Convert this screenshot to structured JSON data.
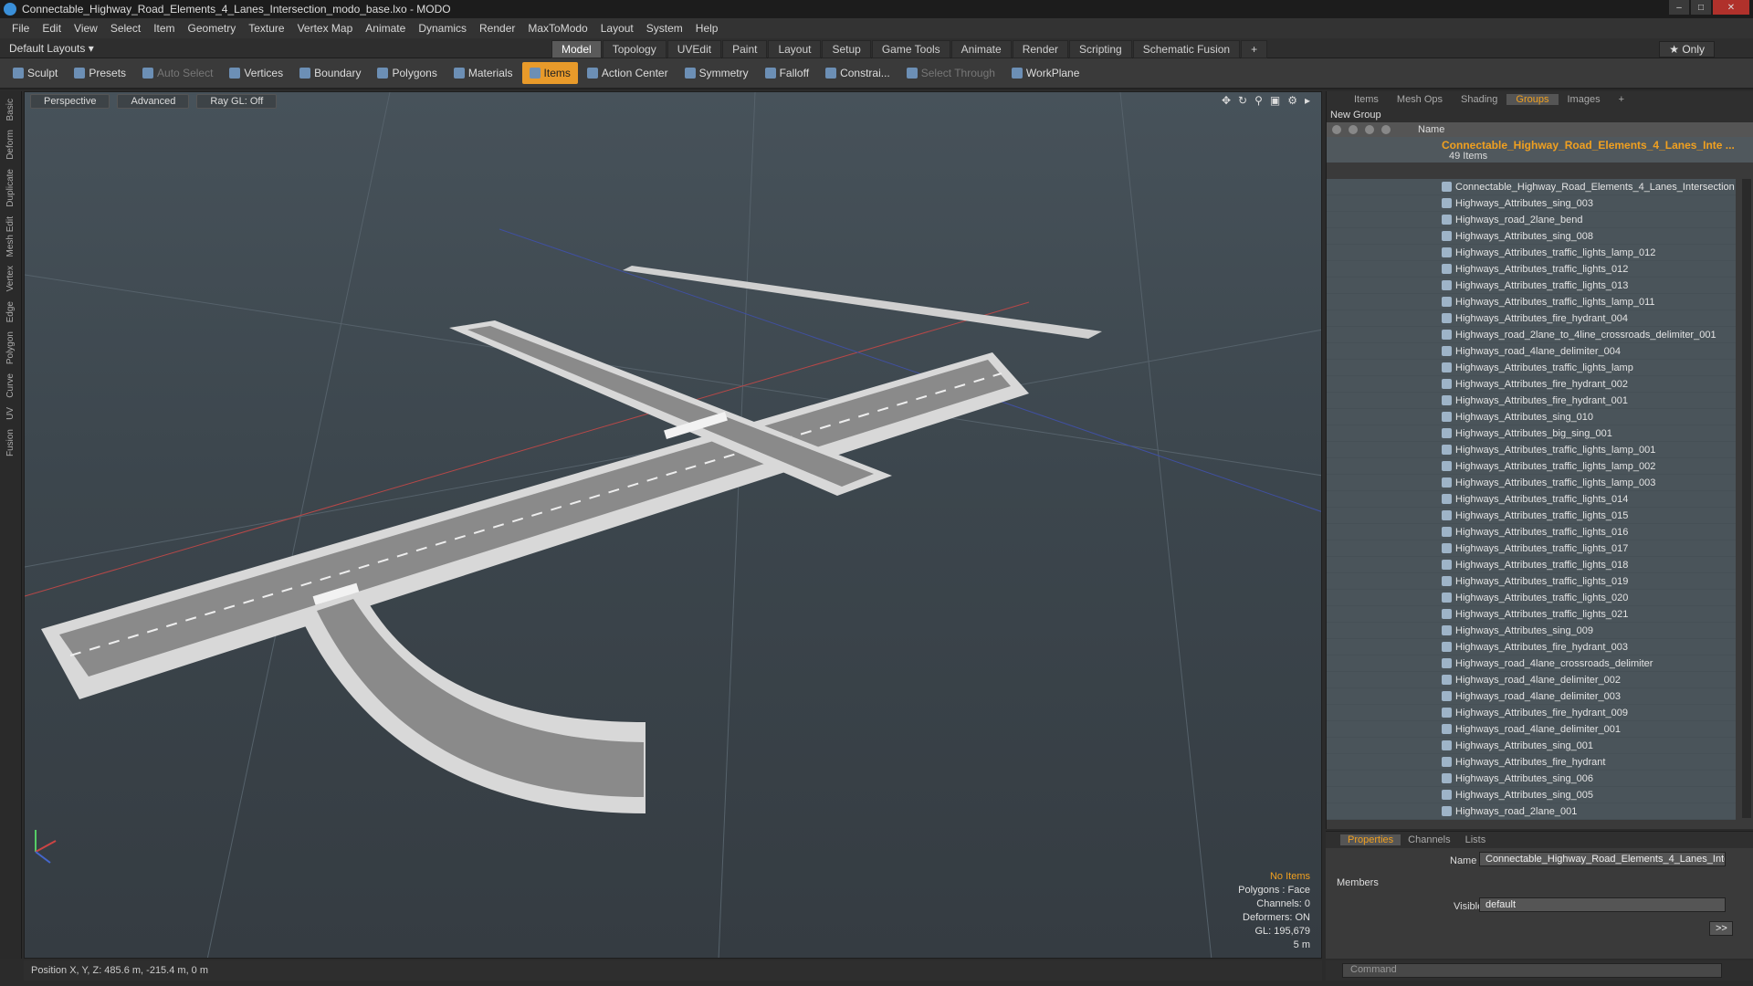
{
  "window": {
    "title": "Connectable_Highway_Road_Elements_4_Lanes_Intersection_modo_base.lxo - MODO"
  },
  "menu": [
    "File",
    "Edit",
    "View",
    "Select",
    "Item",
    "Geometry",
    "Texture",
    "Vertex Map",
    "Animate",
    "Dynamics",
    "Render",
    "MaxToModo",
    "Layout",
    "System",
    "Help"
  ],
  "layout": {
    "default_layouts": "Default Layouts",
    "tabs": [
      "Model",
      "Topology",
      "UVEdit",
      "Paint",
      "Layout",
      "Setup",
      "Game Tools",
      "Animate",
      "Render",
      "Scripting",
      "Schematic Fusion"
    ],
    "active_tab": "Model",
    "only": "Only"
  },
  "toolbar": {
    "sculpt": "Sculpt",
    "presets": "Presets",
    "auto_select": "Auto Select",
    "vertices": "Vertices",
    "boundary": "Boundary",
    "polygons": "Polygons",
    "materials": "Materials",
    "items": "Items",
    "action_center": "Action Center",
    "symmetry": "Symmetry",
    "falloff": "Falloff",
    "constraints": "Constrai...",
    "select_through": "Select Through",
    "workplane": "WorkPlane"
  },
  "left_strip": [
    "Basic",
    "Deform",
    "Duplicate",
    "Mesh Edit",
    "Vertex",
    "Edge",
    "Polygon",
    "Curve",
    "UV",
    "Fusion"
  ],
  "viewport": {
    "perspective": "Perspective",
    "advanced": "Advanced",
    "raygl": "Ray GL: Off",
    "stats": {
      "no_items": "No Items",
      "polygons": "Polygons : Face",
      "channels": "Channels: 0",
      "deformers": "Deformers: ON",
      "gl": "GL: 195,679",
      "scale": "5 m"
    }
  },
  "status": {
    "position": "Position X, Y, Z:   485.6 m, -215.4 m, 0 m"
  },
  "right_panel": {
    "tabs": [
      "Items",
      "Mesh Ops",
      "Shading",
      "Groups",
      "Images"
    ],
    "active_tab": "Groups",
    "new_group": "New Group",
    "name_header": "Name",
    "group_name": "Connectable_Highway_Road_Elements_4_Lanes_Inte ...",
    "group_count": "49 Items",
    "items": [
      "Connectable_Highway_Road_Elements_4_Lanes_Intersection",
      "Highways_Attributes_sing_003",
      "Highways_road_2lane_bend",
      "Highways_Attributes_sing_008",
      "Highways_Attributes_traffic_lights_lamp_012",
      "Highways_Attributes_traffic_lights_012",
      "Highways_Attributes_traffic_lights_013",
      "Highways_Attributes_traffic_lights_lamp_011",
      "Highways_Attributes_fire_hydrant_004",
      "Highways_road_2lane_to_4line_crossroads_delimiter_001",
      "Highways_road_4lane_delimiter_004",
      "Highways_Attributes_traffic_lights_lamp",
      "Highways_Attributes_fire_hydrant_002",
      "Highways_Attributes_fire_hydrant_001",
      "Highways_Attributes_sing_010",
      "Highways_Attributes_big_sing_001",
      "Highways_Attributes_traffic_lights_lamp_001",
      "Highways_Attributes_traffic_lights_lamp_002",
      "Highways_Attributes_traffic_lights_lamp_003",
      "Highways_Attributes_traffic_lights_014",
      "Highways_Attributes_traffic_lights_015",
      "Highways_Attributes_traffic_lights_016",
      "Highways_Attributes_traffic_lights_017",
      "Highways_Attributes_traffic_lights_018",
      "Highways_Attributes_traffic_lights_019",
      "Highways_Attributes_traffic_lights_020",
      "Highways_Attributes_traffic_lights_021",
      "Highways_Attributes_sing_009",
      "Highways_Attributes_fire_hydrant_003",
      "Highways_road_4lane_crossroads_delimiter",
      "Highways_road_4lane_delimiter_002",
      "Highways_road_4lane_delimiter_003",
      "Highways_Attributes_fire_hydrant_009",
      "Highways_road_4lane_delimiter_001",
      "Highways_Attributes_sing_001",
      "Highways_Attributes_fire_hydrant",
      "Highways_Attributes_sing_006",
      "Highways_Attributes_sing_005",
      "Highways_road_2lane_001"
    ]
  },
  "properties": {
    "tabs": [
      "Properties",
      "Channels",
      "Lists"
    ],
    "active_tab": "Properties",
    "name_label": "Name",
    "name_value": "Connectable_Highway_Road_Elements_4_Lanes_Inte",
    "members": "Members",
    "visible_label": "Visible",
    "visible_value": "default",
    "arrow_btn": ">>"
  },
  "command": {
    "placeholder": "Command"
  },
  "colors": {
    "accent": "#e89a2a",
    "group_name": "#f0a020"
  }
}
